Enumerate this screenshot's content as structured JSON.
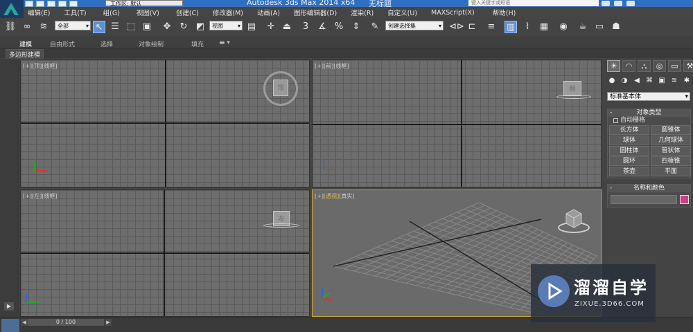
{
  "title_bar": {
    "workspace": "工作区: 默认",
    "title": "Autodesk 3ds Max  2014 x64",
    "subtitle": "无标题",
    "search_placeholder": "键入关键字或短语"
  },
  "menu": [
    "编辑(E)",
    "工具(T)",
    "组(G)",
    "视图(V)",
    "创建(C)",
    "修改器(M)",
    "动画(A)",
    "图形编辑器(D)",
    "渲染(R)",
    "自定义(U)",
    "MAXScript(X)",
    "帮助(H)"
  ],
  "toolbar": {
    "filter_value": "全部",
    "coord_value": "视图",
    "snap_label": "3",
    "selection_set_value": "创建选择集"
  },
  "ribbon": {
    "tabs": [
      "建模",
      "自由形式",
      "选择",
      "对象绘制",
      "填充"
    ],
    "sub_label": "多边形建模"
  },
  "viewports": {
    "top": {
      "label_a": "[+]",
      "label_b": "[顶]",
      "label_c": "[线框]",
      "cube_text": "顶"
    },
    "front": {
      "label_a": "[+]",
      "label_b": "[前]",
      "label_c": "[线框]",
      "cube_text": "前"
    },
    "left": {
      "label_a": "[+]",
      "label_b": "[左]",
      "label_c": "[线框]",
      "cube_text": "左"
    },
    "persp": {
      "label_a": "[+]",
      "label_b": "[透视]",
      "label_c": "[真实]"
    }
  },
  "command_panel": {
    "category": "标准基本体",
    "object_type_title": "对象类型",
    "autogrid_label": "自动栅格",
    "objects": [
      "长方体",
      "圆锥体",
      "球体",
      "几何球体",
      "圆柱体",
      "管状体",
      "圆环",
      "四棱锥",
      "茶壶",
      "平面"
    ],
    "name_color_title": "名称和颜色",
    "swatch_color": "#d13c8a"
  },
  "status": {
    "timeline_text": "0 / 100"
  },
  "watermark": {
    "title": "溜溜自学",
    "url": "ZIXUE.3D66.COM"
  }
}
